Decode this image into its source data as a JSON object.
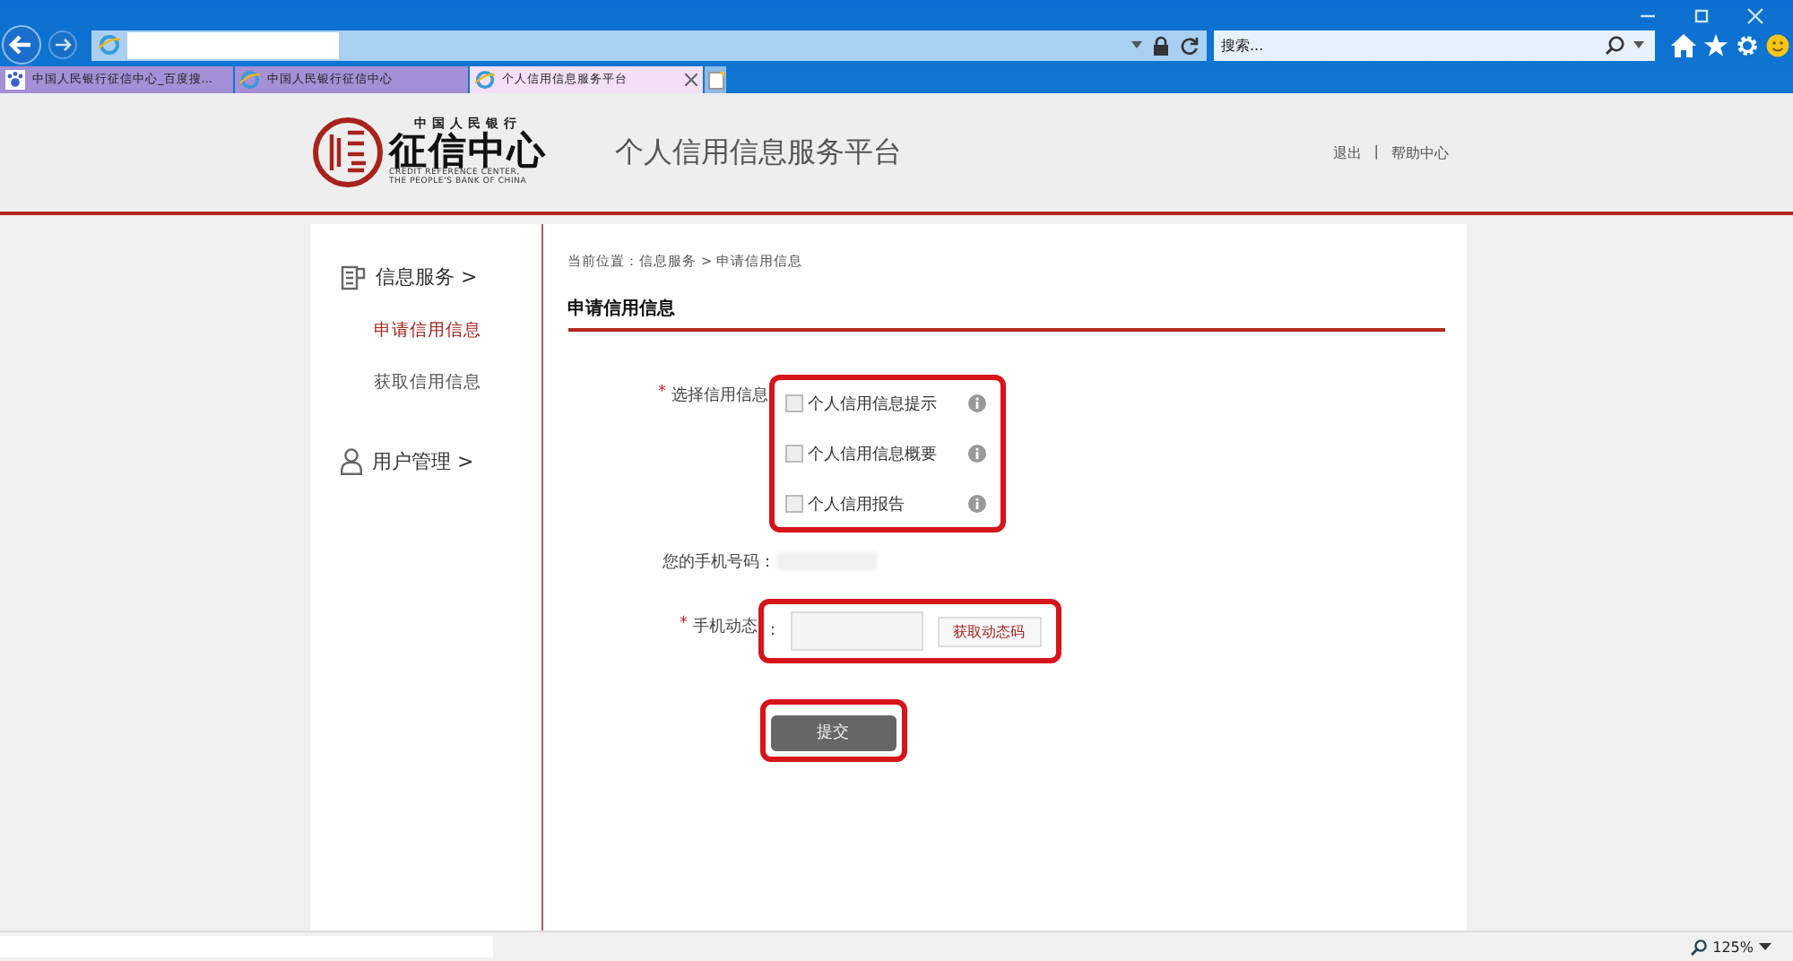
{
  "browser": {
    "search": {
      "placeholder": "搜索..."
    },
    "tabs": [
      {
        "label": "中国人民银行征信中心_百度搜...",
        "selected": false,
        "kind": "paw"
      },
      {
        "label": "中国人民银行征信中心",
        "selected": false,
        "kind": "ie"
      },
      {
        "label": "个人信用信息服务平台",
        "selected": true,
        "kind": "ie"
      }
    ],
    "zoom": "125%"
  },
  "header": {
    "logo": {
      "top": "中国人民银行",
      "name": "征信中心",
      "en_line_1": "CREDIT REFERENCE CENTER,",
      "en_line_2": "THE PEOPLE'S BANK OF CHINA"
    },
    "title": "个人信用信息服务平台",
    "links": [
      "退出",
      "帮助中心"
    ],
    "separator": "|"
  },
  "sidebar": {
    "sections": [
      {
        "label": "信息服务 >",
        "kind": "doc",
        "items": [
          {
            "label": "申请信用信息",
            "selected": true
          },
          {
            "label": "获取信用信息",
            "selected": false
          }
        ]
      },
      {
        "label": "用户管理 >",
        "kind": "user"
      }
    ]
  },
  "breadcrumb": "当前位置：信息服务 > 申请信用信息",
  "heading": "申请信用信息",
  "form": {
    "credit_label": "选择信用信息",
    "required_mark": "*",
    "options": [
      {
        "label": "个人信用信息提示",
        "checked": false
      },
      {
        "label": "个人信用信息概要",
        "checked": false
      },
      {
        "label": "个人信用报告",
        "checked": false
      }
    ],
    "phone_label": "您的手机号码：",
    "code_label": "手机动态",
    "code_colon": ":",
    "get_code_button": "获取动态码",
    "submit_button": "提交"
  }
}
